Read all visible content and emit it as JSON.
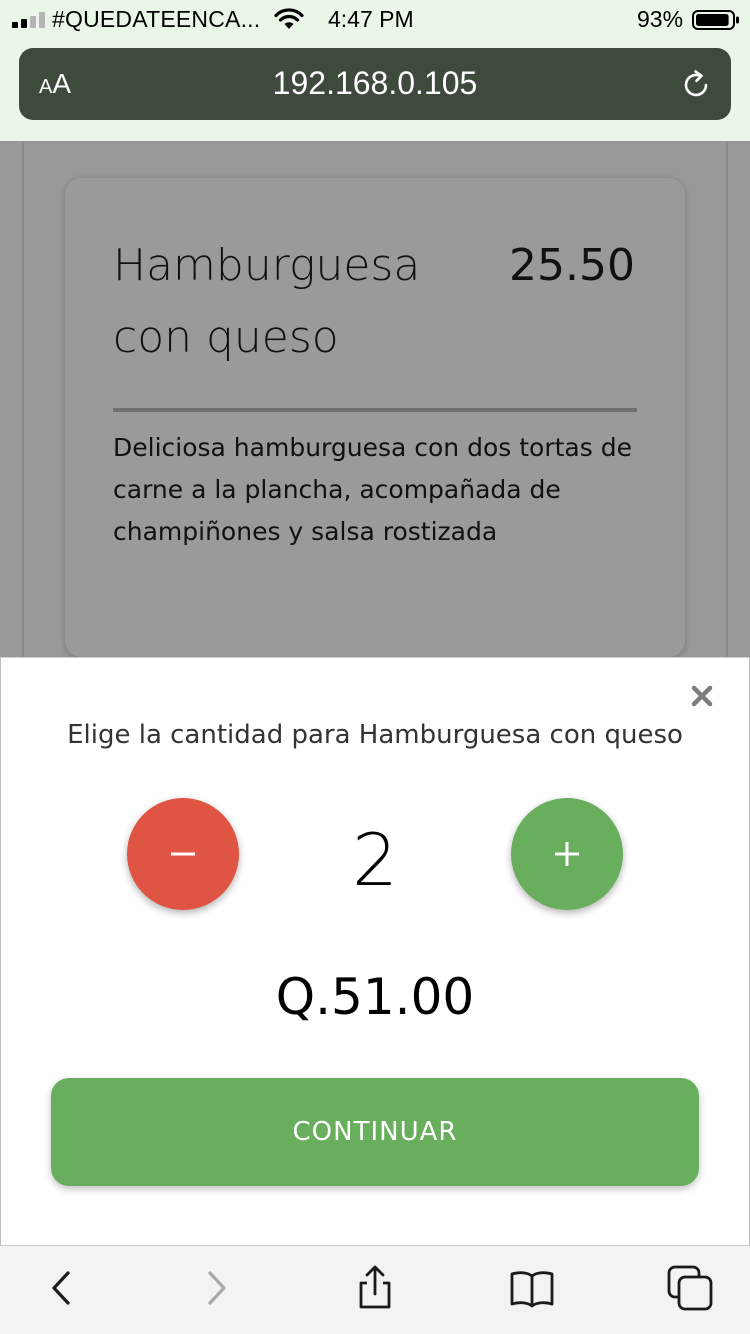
{
  "status_bar": {
    "carrier": "#QUEDATEENCA...",
    "time": "4:47 PM",
    "battery_percent": "93%",
    "battery_level": 0.93,
    "signal_icon": "signal-bars-icon",
    "wifi_icon": "wifi-icon"
  },
  "browser": {
    "text_size_label_small": "A",
    "text_size_label_large": "A",
    "url": "192.168.0.105",
    "reload_icon": "reload-icon"
  },
  "product_card": {
    "title": "Hamburguesa con queso",
    "price": "25.50",
    "description": "Deliciosa hamburguesa con dos tortas de carne a la plancha, acompañada de champiñones y salsa rostizada"
  },
  "quantity_modal": {
    "prompt": "Elige la cantidad para Hamburguesa con queso",
    "quantity": "2",
    "total": "Q.51.00",
    "continue_label": "CONTINUAR",
    "decrement_icon": "minus-icon",
    "increment_icon": "plus-icon",
    "close_icon": "close-icon"
  },
  "toolbar": {
    "back_icon": "back-arrow-icon",
    "forward_icon": "forward-arrow-icon",
    "share_icon": "share-icon",
    "bookmarks_icon": "bookmarks-icon",
    "tabs_icon": "tabs-icon"
  },
  "colors": {
    "chrome_tint": "#eaf7e8",
    "url_bar": "#3e4a3c",
    "minus_button": "#e05444",
    "plus_button": "#68ae5c",
    "continue_button": "#68ae5c",
    "overlay_gray": "#999999"
  }
}
